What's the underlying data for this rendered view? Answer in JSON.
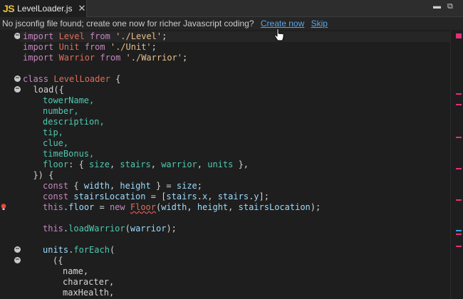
{
  "tab": {
    "icon_text": "JS",
    "filename": "LevelLoader.js",
    "close_glyph": "✕"
  },
  "window": {
    "minimize_glyph": "▬",
    "restore_glyph": "⧉"
  },
  "infobar": {
    "message": "No jsconfig file found; create one now for richer Javascript coding?",
    "create_label": "Create now",
    "skip_label": "Skip"
  },
  "colors": {
    "accent_link": "#5ba6e6",
    "js_icon": "#e8c33a",
    "marker": "#e0307a"
  },
  "code": {
    "l1": [
      "import",
      " Level ",
      "from",
      " ",
      "'./Level'",
      ";"
    ],
    "l2": [
      "import",
      " Unit ",
      "from",
      " ",
      "'./Unit'",
      ";"
    ],
    "l3": [
      "import",
      " Warrior ",
      "from",
      " ",
      "'./Warrior'",
      ";"
    ],
    "l5": [
      "class",
      " ",
      "LevelLoader",
      " {"
    ],
    "l6": "  load({",
    "l7": "towerName,",
    "l8": "number,",
    "l9": "description,",
    "l10": "tip,",
    "l11": "clue,",
    "l12": "timeBonus,",
    "l13": [
      "floor",
      ": { ",
      "size",
      ", ",
      "stairs",
      ", ",
      "warrior",
      ", ",
      "units",
      " },"
    ],
    "l14": "  }) {",
    "l15": [
      "const",
      " { ",
      "width",
      ", ",
      "height",
      " } = ",
      "size",
      ";"
    ],
    "l16": [
      "const",
      " ",
      "stairsLocation",
      " = [",
      "stairs",
      ".",
      "x",
      ", ",
      "stairs",
      ".",
      "y",
      "];"
    ],
    "l17": [
      "this",
      ".",
      "floor",
      " = ",
      "new",
      " ",
      "Floor",
      "(",
      "width",
      ", ",
      "height",
      ", ",
      "stairsLocation",
      ");"
    ],
    "l19": [
      "this",
      ".",
      "loadWarrior",
      "(",
      "warrior",
      ");"
    ],
    "l21": [
      "units",
      ".",
      "forEach",
      "("
    ],
    "l22": "({",
    "l23": "name,",
    "l24": "character,",
    "l25": "maxHealth,"
  }
}
